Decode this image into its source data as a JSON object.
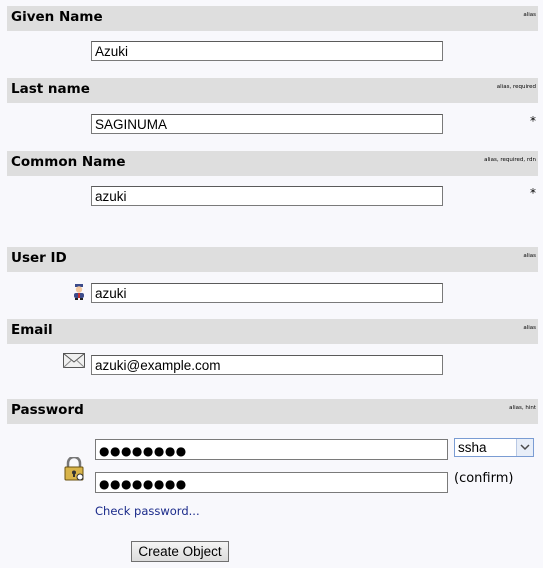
{
  "given_name": {
    "label": "Given Name",
    "hint": "alias",
    "value": "Azuki"
  },
  "last_name": {
    "label": "Last name",
    "hint": "alias, required",
    "value": "SAGINUMA",
    "required_mark": "*"
  },
  "common_name": {
    "label": "Common Name",
    "hint": "alias, required, rdn",
    "value": "azuki",
    "required_mark": "*"
  },
  "user_id": {
    "label": "User ID",
    "hint": "alias",
    "value": "azuki",
    "icon": "user-icon"
  },
  "email": {
    "label": "Email",
    "hint": "alias",
    "value": "azuki@example.com",
    "icon": "envelope-icon"
  },
  "password": {
    "label": "Password",
    "hint": "alias, hint",
    "masked": "●●●●●●●●",
    "confirm_masked": "●●●●●●●●",
    "hash": "ssha",
    "confirm_label": "(confirm)",
    "check_link": "Check password...",
    "icon": "lock-icon"
  },
  "submit_label": "Create Object",
  "colors": {
    "header_bg": "#dedede",
    "page_bg": "#f8f8fc",
    "link": "#1a2a8a"
  }
}
